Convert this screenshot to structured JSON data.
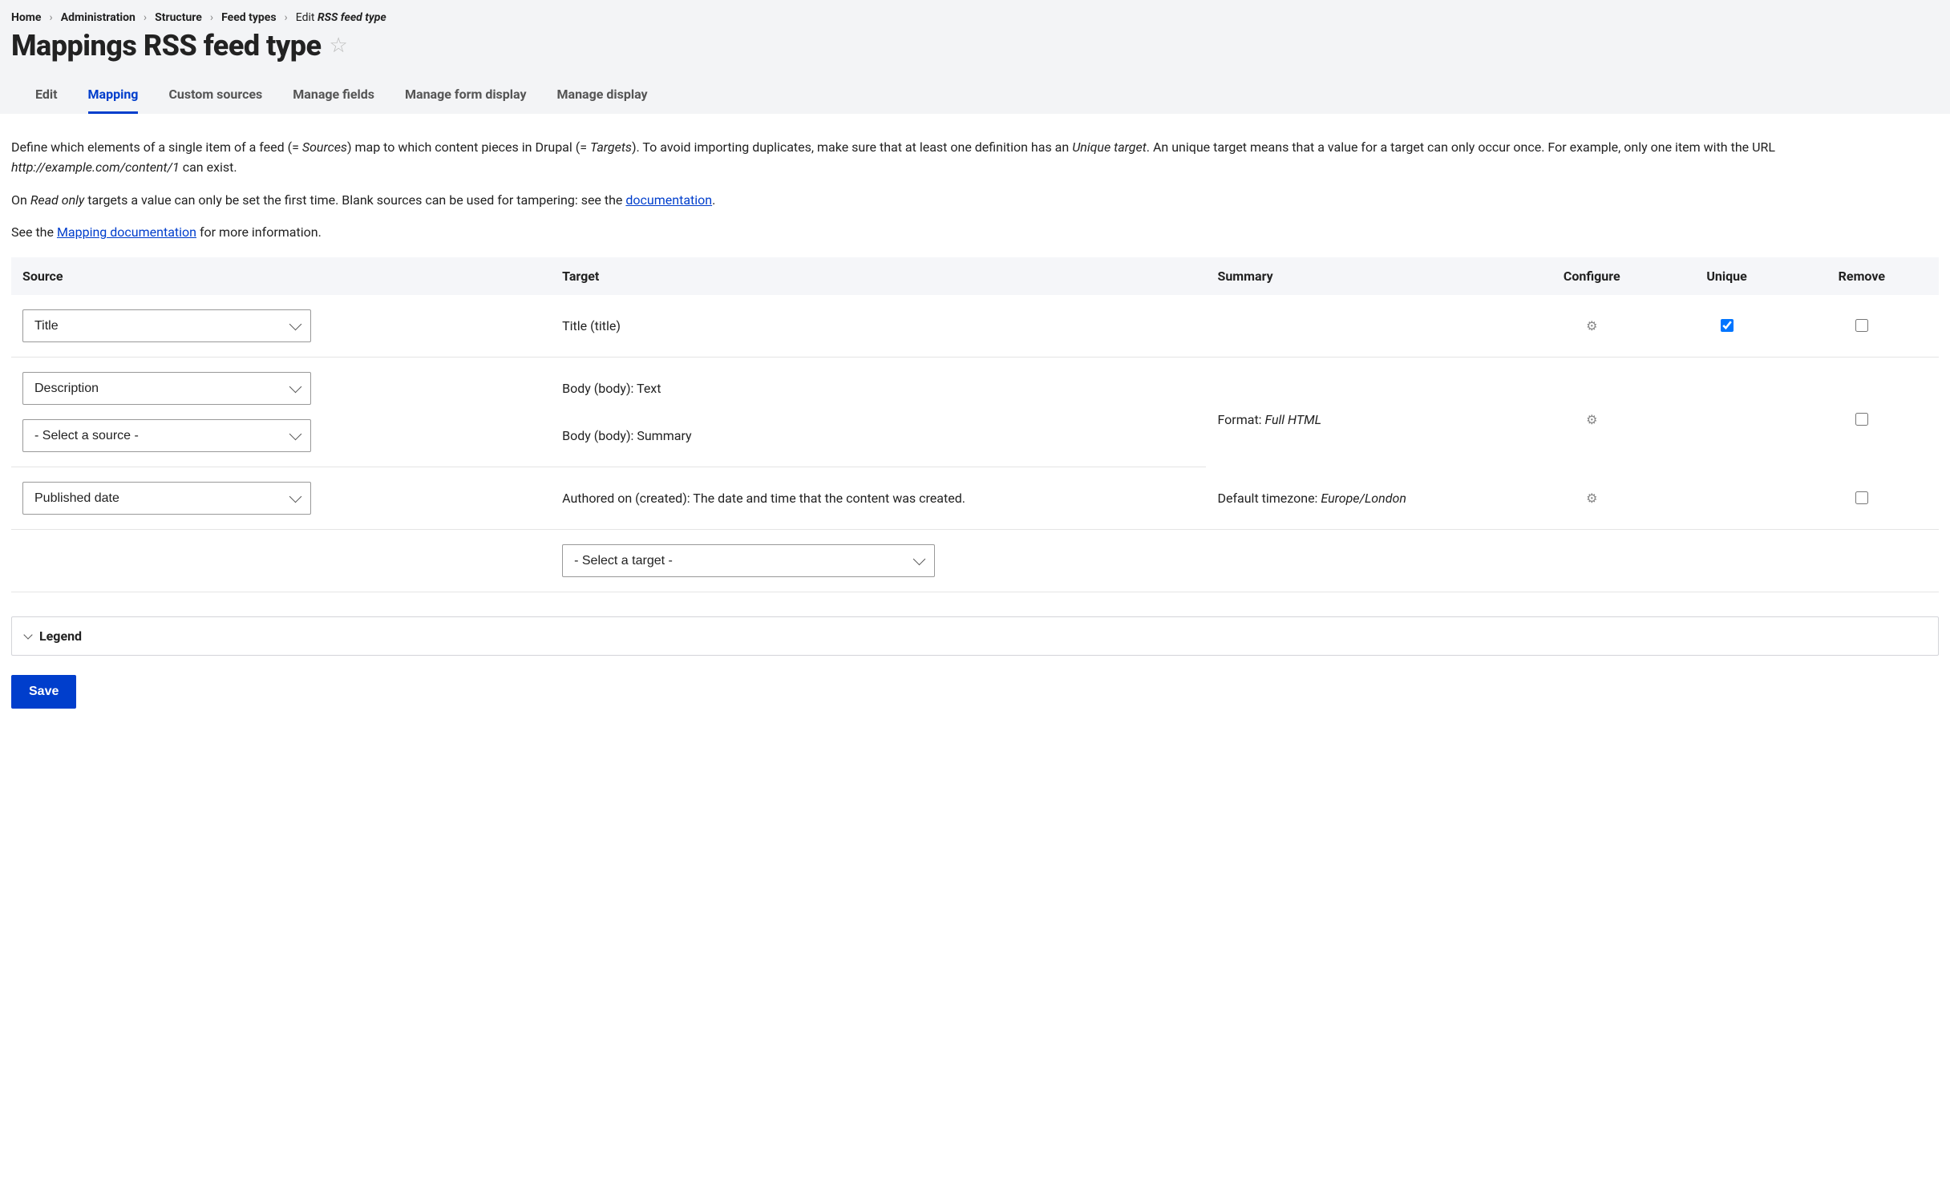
{
  "breadcrumbs": [
    {
      "label": "Home"
    },
    {
      "label": "Administration"
    },
    {
      "label": "Structure"
    },
    {
      "label": "Feed types"
    },
    {
      "prefix": "Edit ",
      "em": "RSS feed type"
    }
  ],
  "page_title": "Mappings RSS feed type",
  "tabs": [
    {
      "label": "Edit",
      "active": false
    },
    {
      "label": "Mapping",
      "active": true
    },
    {
      "label": "Custom sources",
      "active": false
    },
    {
      "label": "Manage fields",
      "active": false
    },
    {
      "label": "Manage form display",
      "active": false
    },
    {
      "label": "Manage display",
      "active": false
    }
  ],
  "intro": {
    "p1_a": "Define which elements of a single item of a feed (= ",
    "p1_b": "Sources",
    "p1_c": ") map to which content pieces in Drupal (= ",
    "p1_d": "Targets",
    "p1_e": "). To avoid importing duplicates, make sure that at least one definition has an ",
    "p1_f": "Unique target",
    "p1_g": ". An unique target means that a value for a target can only occur once. For example, only one item with the URL ",
    "p1_h": "http://example.com/content/1",
    "p1_i": " can exist.",
    "p2_a": "On ",
    "p2_b": "Read only",
    "p2_c": " targets a value can only be set the first time. Blank sources can be used for tampering: see the ",
    "p2_link1": "documentation",
    "p2_d": ".",
    "p3_a": "See the ",
    "p3_link": "Mapping documentation",
    "p3_b": " for more information."
  },
  "columns": {
    "source": "Source",
    "target": "Target",
    "summary": "Summary",
    "configure": "Configure",
    "unique": "Unique",
    "remove": "Remove"
  },
  "rows": [
    {
      "source": "Title",
      "target": "Title (title)",
      "summary": "",
      "configure": true,
      "unique_checked": true,
      "show_unique": true
    },
    {
      "source": "Description",
      "target": "Body (body): Text",
      "sub_source": "- Select a source -",
      "sub_target": "Body (body): Summary",
      "summary_label": "Format: ",
      "summary_value": "Full HTML",
      "configure": true,
      "unique_checked": false,
      "show_unique": false
    },
    {
      "source": "Published date",
      "target": "Authored on (created): The date and time that the content was created.",
      "summary_label": "Default timezone: ",
      "summary_value": "Europe/London",
      "configure": true,
      "unique_checked": false,
      "show_unique": false
    }
  ],
  "new_target_placeholder": "- Select a target -",
  "legend_label": "Legend",
  "save_label": "Save"
}
